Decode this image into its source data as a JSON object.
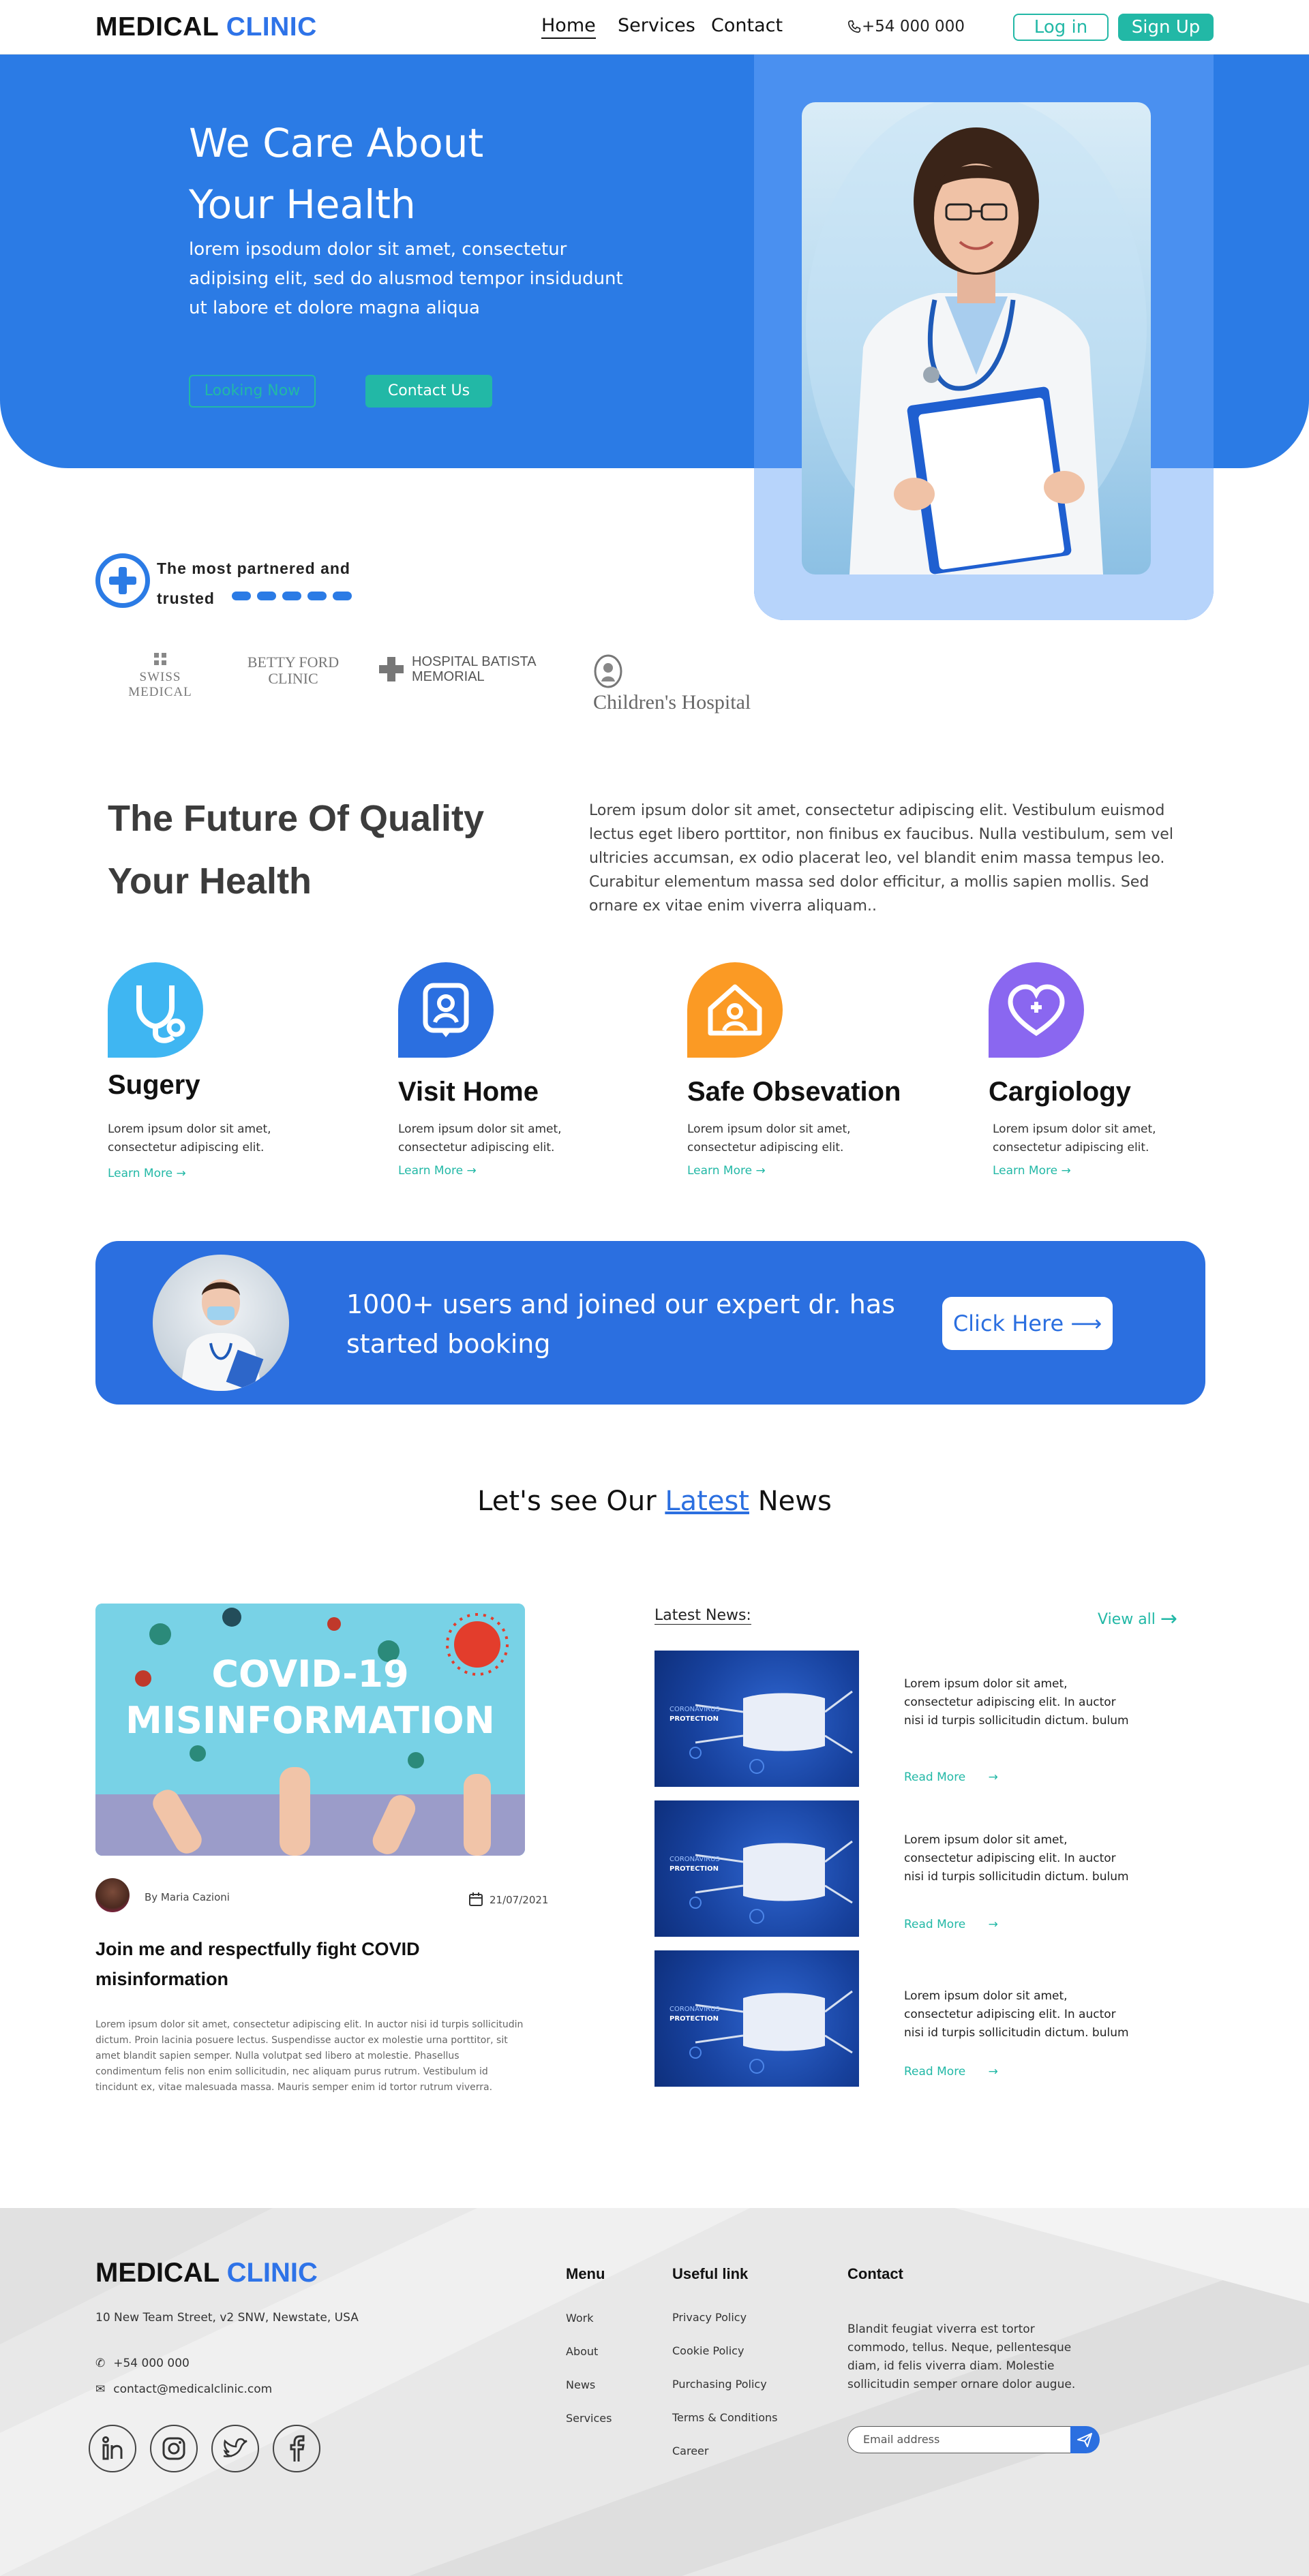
{
  "nav": {
    "logo_a": "MEDICAL",
    "logo_b": "CLINIC",
    "links": [
      "Home",
      "Services",
      "Contact"
    ],
    "phone": "+54 000 000",
    "login": "Log in",
    "signup": "Sign Up"
  },
  "hero": {
    "title": "We Care About Your Health",
    "subtitle": "lorem ipsodum dolor sit amet, consectetur adipising elit, sed do alusmod tempor insidudunt ut labore et dolore magna aliqua",
    "btn_looking": "Looking Now",
    "btn_contact": "Contact Us"
  },
  "partners": {
    "text": "The most partnered and trusted",
    "logos": [
      "SWISS MEDICAL",
      "BETTY FORD CLINIC",
      "HOSPITAL BATISTA MEMORIAL",
      "Children's Hospital"
    ]
  },
  "future": {
    "title": "The Future Of Quality Your Health",
    "text": "Lorem ipsum dolor sit amet, consectetur adipiscing elit. Vestibulum euismod lectus eget libero porttitor, non finibus ex faucibus. Nulla vestibulum, sem vel ultricies accumsan, ex odio placerat leo, vel blandit enim massa tempus leo. Curabitur elementum massa sed dolor efficitur, a mollis sapien mollis. Sed ornare ex vitae enim viverra aliquam.."
  },
  "services": [
    {
      "title": "Sugery",
      "text": "Lorem ipsum dolor sit amet, consectetur adipiscing elit.",
      "link": "Learn More",
      "color": "#3fb6f2",
      "icon": "stethoscope-icon"
    },
    {
      "title": "Visit Home",
      "text": "Lorem ipsum dolor sit amet, consectetur adipiscing elit.",
      "link": "Learn More",
      "color": "#2b6fe0",
      "icon": "user-badge-icon"
    },
    {
      "title": "Safe Obsevation",
      "text": "Lorem ipsum dolor sit amet, consectetur adipiscing elit.",
      "link": "Learn More",
      "color": "#fb9a24",
      "icon": "home-user-icon"
    },
    {
      "title": "Cargiology",
      "text": "Lorem ipsum dolor sit amet, consectetur adipiscing elit.",
      "link": "Learn More",
      "color": "#8a67f0",
      "icon": "heart-plus-icon"
    }
  ],
  "cta": {
    "text": "1000+ users and joined our expert dr. has started booking",
    "button": "Click Here"
  },
  "news": {
    "heading_a": "Let's see Our",
    "heading_b": "Latest",
    "heading_c": "News",
    "main": {
      "image_title_1": "COVID-19",
      "image_title_2": "MISINFORMATION",
      "author": "By Maria Cazioni",
      "date": "21/07/2021",
      "title": "Join me and respectfully fight COVID misinformation",
      "body": "Lorem ipsum dolor sit amet, consectetur adipiscing elit. In auctor nisi id turpis sollicitudin dictum. Proin lacinia posuere lectus. Suspendisse auctor ex molestie urna porttitor, sit amet blandit sapien semper. Nulla volutpat sed libero at molestie. Phasellus condimentum felis non enim sollicitudin, nec aliquam purus rutrum. Vestibulum id tincidunt ex, vitae malesuada massa. Mauris semper enim id tortor rutrum viverra."
    },
    "latest_label": "Latest News:",
    "view_all": "View all",
    "items": [
      {
        "image_caption_1": "CORONAVIRUS",
        "image_caption_2": "PROTECTION",
        "text": "Lorem ipsum dolor sit amet, consectetur adipiscing elit. In auctor nisi id turpis sollicitudin dictum. bulum",
        "read_more": "Read More"
      },
      {
        "image_caption_1": "CORONAVIRUS",
        "image_caption_2": "PROTECTION",
        "text": "Lorem ipsum dolor sit amet, consectetur adipiscing elit. In auctor nisi id turpis sollicitudin dictum. bulum",
        "read_more": "Read More"
      },
      {
        "image_caption_1": "CORONAVIRUS",
        "image_caption_2": "PROTECTION",
        "text": "Lorem ipsum dolor sit amet, consectetur adipiscing elit. In auctor nisi id turpis sollicitudin dictum. bulum",
        "read_more": "Read More"
      }
    ]
  },
  "footer": {
    "logo_a": "MEDICAL",
    "logo_b": "CLINIC",
    "address": "10 New Team Street, v2 SNW, Newstate, USA",
    "phone": "+54 000 000",
    "email": "contact@medicalclinic.com",
    "social": [
      "linkedin-icon",
      "instagram-icon",
      "twitter-icon",
      "facebook-icon"
    ],
    "menu_title": "Menu",
    "menu": [
      "Work",
      "About",
      "News",
      "Services"
    ],
    "useful_title": "Useful link",
    "useful": [
      "Privacy Policy",
      "Cookie Policy",
      "Purchasing Policy",
      "Terms & Conditions",
      "Career"
    ],
    "contact_title": "Contact",
    "contact_text": "Blandit feugiat viverra est tortor commodo, tellus. Neque, pellentesque diam, id felis viverra diam. Molestie sollicitudin semper ornare dolor augue.",
    "email_placeholder": "Email address"
  },
  "colors": {
    "primary": "#2b7be5",
    "accent": "#22b8a6"
  }
}
